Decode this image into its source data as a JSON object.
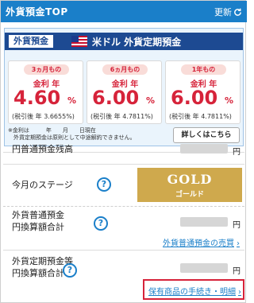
{
  "header": {
    "title": "外貨預金TOP",
    "update_label": "更新"
  },
  "promo": {
    "tag": "外貨預金",
    "headline": "米ドル 外貨定期預金",
    "cards": [
      {
        "term": "3ヵ月もの",
        "rate_label": "金利 年",
        "rate": "4.60",
        "unit": "%",
        "pretax": "(税引後 年 3.6655%)"
      },
      {
        "term": "6ヵ月もの",
        "rate_label": "金利 年",
        "rate": "6.00",
        "unit": "%",
        "pretax": "(税引後 年 4.7811%)"
      },
      {
        "term": "1年もの",
        "rate_label": "金利 年",
        "rate": "6.00",
        "unit": "%",
        "pretax": "(税引後 年 4.7811%)"
      }
    ],
    "note_line1": "※金利は　　　年　　月　　日現在",
    "note_line2": "　外貨定期預金は原則として中途解約できません。",
    "detail_label": "詳しくはこちら"
  },
  "account": {
    "balance_label": "円普通預金残高",
    "yen": "円",
    "stage_label": "今月のステージ",
    "stage_en": "GOLD",
    "stage_jp": "ゴールド",
    "fx_label_1": "外貨普通預金",
    "fx_label_2": "円換算額合計",
    "fx_link": "外貨普通預金の売買",
    "fixed_label_1": "外貨定期預金等",
    "fixed_label_2": "円換算額合計",
    "holdings_link": "保有商品の手続き・明細"
  },
  "colors": {
    "header_blue": "#1a7fc9",
    "band_navy": "#1d4a92",
    "rate_red": "#d6233a",
    "gold": "#cfa94d"
  },
  "icons": {
    "refresh": "refresh-icon",
    "flag": "us-flag-icon",
    "help": "help-icon",
    "chevron": "chevron-right-icon"
  }
}
